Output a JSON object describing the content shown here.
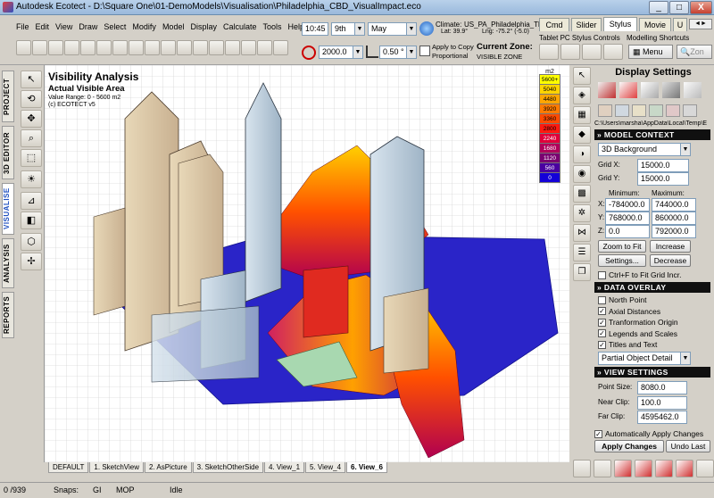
{
  "window": {
    "title": "Autodesk Ecotect - D:\\Square One\\01-DemoModels\\Visualisation\\Philadelphia_CBD_VisualImpact.eco",
    "controls": {
      "min": "_",
      "max": "□",
      "close": "X"
    }
  },
  "menu": [
    "File",
    "Edit",
    "View",
    "Draw",
    "Select",
    "Modify",
    "Model",
    "Display",
    "Calculate",
    "Tools",
    "Help"
  ],
  "time_controls": {
    "time": "10:45",
    "day": "9th",
    "month": "May"
  },
  "climate": {
    "label": "Climate:",
    "value": "US_PA_Philadelphia_Th",
    "lat": "Lat: 39.9°",
    "lng": "Lng: -75.2° (-5.0)"
  },
  "snap": {
    "grid_value": "2000.0",
    "angle_value": "0.50 °",
    "apply_to_copy": "Apply to Copy",
    "proportional": "Proportional"
  },
  "current_zone": {
    "label": "Current Zone:",
    "value": "VISIBLE ZONE"
  },
  "right_tabs": [
    "Cmd",
    "Slider",
    "Stylus",
    "Movie",
    "U"
  ],
  "stylus_bar": {
    "tablet": "Tablet PC Stylus Controls",
    "modelling": "Modelling Shortcuts",
    "menu": "Menu",
    "zoom": "Zon"
  },
  "left_tabs": [
    "PROJECT",
    "3D EDITOR",
    "VISUALISE",
    "ANALYSIS",
    "REPORTS"
  ],
  "left_icons": [
    "pointer-icon",
    "orbit-icon",
    "pan-icon",
    "zoom-icon",
    "select-icon",
    "sun-icon",
    "section-icon",
    "solid-icon",
    "cube-icon",
    "move-icon"
  ],
  "viewport": {
    "title": "Visibility Analysis",
    "subtitle": "Actual Visible Area",
    "range": "Value Range: 0 - 5600 m2",
    "copyright": "(c) ECOTECT v5"
  },
  "legend": {
    "unit": "m2",
    "values": [
      "5600+",
      "5040",
      "4480",
      "3920",
      "3360",
      "2800",
      "2240",
      "1680",
      "1120",
      "560",
      "0"
    ],
    "colors": [
      "#ffff00",
      "#ffd400",
      "#ffa500",
      "#ff7a00",
      "#ff4a00",
      "#ff1a10",
      "#e0003a",
      "#b0005a",
      "#7a0070",
      "#4a00a0",
      "#1400d8"
    ]
  },
  "view_tabs": [
    "DEFAULT",
    "1. SketchView",
    "2. AsPicture",
    "3. SketchOtherSide",
    "4. View_1",
    "5. View_4",
    "6. View_6"
  ],
  "status": {
    "count": "0 /939",
    "snaps_label": "Snaps:",
    "snaps_gi": "GI",
    "snaps_mop": "MOP",
    "state": "Idle"
  },
  "display_settings": {
    "title": "Display Settings",
    "path": "C:\\Users\\marsha\\AppData\\Local\\Temp\\E",
    "model_context": {
      "header": "MODEL CONTEXT",
      "background": "3D Background",
      "grid_x_label": "Grid X:",
      "grid_x": "15000.0",
      "grid_y_label": "Grid Y:",
      "grid_y": "15000.0",
      "min_label": "Minimum:",
      "max_label": "Maximum:",
      "x_label": "X:",
      "x_min": "-784000.0",
      "x_max": "744000.0",
      "y_label": "Y:",
      "y_min": "768000.0",
      "y_max": "860000.0",
      "z_label": "Z:",
      "z_min": "0.0",
      "z_max": "792000.0",
      "zoom_to_fit": "Zoom to Fit",
      "increase": "Increase",
      "settings": "Settings...",
      "decrease": "Decrease",
      "fit_grid": "Ctrl+F to Fit Grid Incr."
    },
    "data_overlay": {
      "header": "DATA OVERLAY",
      "items": [
        {
          "label": "North Point",
          "checked": false
        },
        {
          "label": "Axial Distances",
          "checked": true
        },
        {
          "label": "Tranformation Origin",
          "checked": true
        },
        {
          "label": "Legends and Scales",
          "checked": true
        },
        {
          "label": "Titles and Text",
          "checked": true
        }
      ],
      "detail": "Partial Object Detail"
    },
    "view_settings": {
      "header": "VIEW SETTINGS",
      "point_size_label": "Point Size:",
      "point_size": "8080.0",
      "near_clip_label": "Near Clip:",
      "near_clip": "100.0",
      "far_clip_label": "Far Clip:",
      "far_clip": "4595462.0"
    },
    "auto_apply": "Automatically Apply Changes",
    "apply_changes": "Apply Changes",
    "undo_last": "Undo Last"
  }
}
